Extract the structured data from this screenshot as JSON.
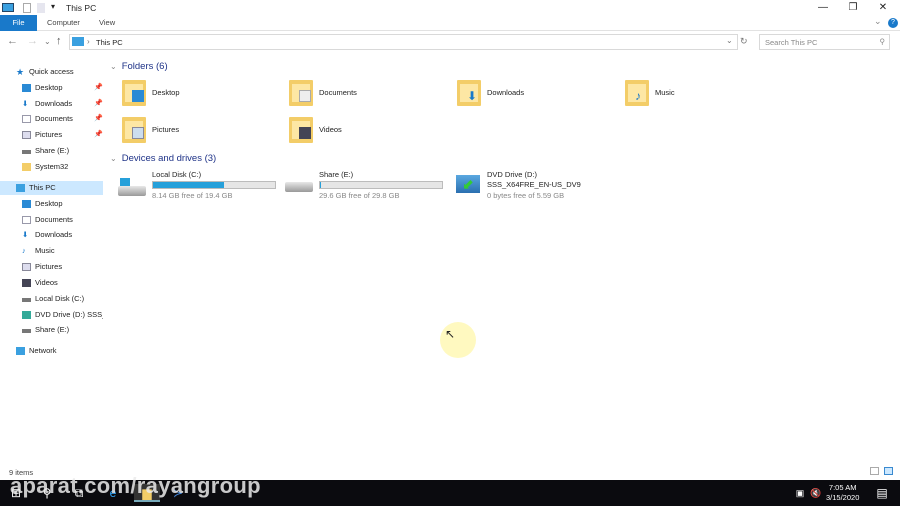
{
  "window": {
    "title": "This PC",
    "min": "—",
    "max": "❐",
    "close": "✕",
    "help": "?"
  },
  "ribbon": {
    "tabs": [
      "File",
      "Computer",
      "View"
    ]
  },
  "address": {
    "path": "This PC",
    "search_placeholder": "Search This PC"
  },
  "sidebar": {
    "quick_access": "Quick access",
    "qa_items": [
      "Desktop",
      "Downloads",
      "Documents",
      "Pictures",
      "Share (E:)",
      "System32"
    ],
    "this_pc": "This PC",
    "pc_items": [
      "Desktop",
      "Documents",
      "Downloads",
      "Music",
      "Pictures",
      "Videos",
      "Local Disk (C:)",
      "DVD Drive (D:) SSS_X",
      "Share (E:)"
    ],
    "network": "Network"
  },
  "folders": {
    "header": "Folders (6)",
    "items": [
      "Desktop",
      "Documents",
      "Downloads",
      "Music",
      "Pictures",
      "Videos"
    ]
  },
  "drives": {
    "header": "Devices and drives (3)",
    "items": [
      {
        "name": "Local Disk (C:)",
        "free": "8.14 GB free of 19.4 GB",
        "used_percent": 58
      },
      {
        "name": "Share (E:)",
        "free": "29.6 GB free of 29.8 GB",
        "used_percent": 1
      },
      {
        "name": "DVD Drive (D:)",
        "label": "SSS_X64FRE_EN-US_DV9",
        "free": "0 bytes free of 5.59 GB"
      }
    ]
  },
  "status": {
    "items": "9 items"
  },
  "taskbar": {
    "time": "7:05 AM",
    "date": "3/15/2020",
    "watermark": "aparat.com/rayangroup"
  },
  "colors": {
    "accent": "#1979ca",
    "bar": "#26a0da",
    "selected": "#cce8ff"
  }
}
